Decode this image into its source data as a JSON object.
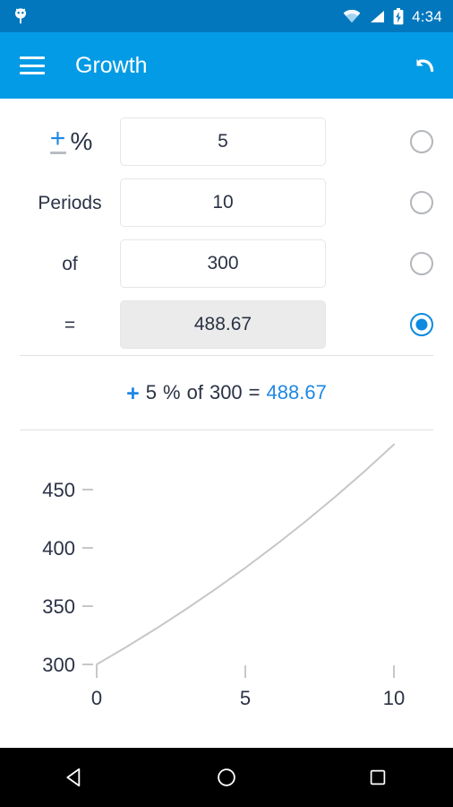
{
  "status_bar": {
    "notification_icon": "android-robot-icon",
    "wifi_icon": "wifi-icon",
    "signal_icon": "cell-signal-icon",
    "battery_icon": "battery-charging-icon",
    "time": "4:34",
    "background_color": "#0277bd"
  },
  "app_bar": {
    "menu_icon": "hamburger-menu-icon",
    "title": "Growth",
    "undo_icon": "undo-icon",
    "background_color": "#039be5"
  },
  "form": {
    "rows": [
      {
        "label": "+%",
        "label_kind": "plus-minus-percent",
        "plus": "+",
        "percent": "%",
        "value": "5",
        "placeholder": "",
        "selected": false,
        "readonly": false
      },
      {
        "label": "Periods",
        "label_kind": "text",
        "value": "10",
        "placeholder": "",
        "selected": false,
        "readonly": false
      },
      {
        "label": "of",
        "label_kind": "text",
        "value": "300",
        "placeholder": "",
        "selected": false,
        "readonly": false
      },
      {
        "label": "=",
        "label_kind": "text",
        "value": "488.67",
        "placeholder": "",
        "selected": true,
        "readonly": true
      }
    ]
  },
  "summary": {
    "operator": "+",
    "rate": "5",
    "percent_sign": "%",
    "of_word": "of",
    "principal": "300",
    "equals": "=",
    "result": "488.67",
    "accent_color": "#1e88e5"
  },
  "chart_data": {
    "type": "line",
    "title": "",
    "xlabel": "",
    "ylabel": "",
    "x": [
      0,
      1,
      2,
      3,
      4,
      5,
      6,
      7,
      8,
      9,
      10
    ],
    "values": [
      300,
      315,
      330.75,
      347.29,
      364.65,
      382.88,
      402.03,
      422.13,
      443.24,
      465.4,
      488.67
    ],
    "series": [
      {
        "name": "Growth",
        "values": [
          300,
          315,
          330.75,
          347.29,
          364.65,
          382.88,
          402.03,
          422.13,
          443.24,
          465.4,
          488.67
        ]
      }
    ],
    "xlim": [
      0,
      10
    ],
    "ylim": [
      300,
      488.67
    ],
    "xticks": [
      0,
      5,
      10
    ],
    "xtick_labels": [
      "0",
      "5",
      "10"
    ],
    "yticks": [
      300,
      350,
      400,
      450
    ],
    "ytick_labels": [
      "300",
      "350",
      "400",
      "450"
    ],
    "grid": false,
    "legend": "none",
    "line_color": "#c7c7c7",
    "tick_color": "#c7c7c7",
    "label_color": "#2b3245"
  },
  "nav_bar": {
    "back_icon": "back-triangle-icon",
    "home_icon": "home-circle-icon",
    "recents_icon": "recents-square-icon",
    "background_color": "#000000"
  }
}
